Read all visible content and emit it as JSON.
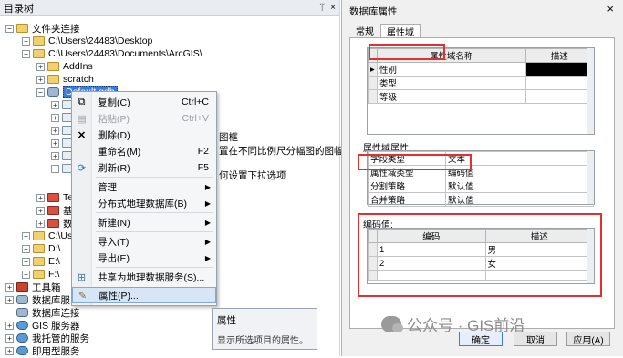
{
  "catalog": {
    "title": "目录树",
    "pin": "ᛘ",
    "close": "×",
    "root": "文件夹连接",
    "nodes": [
      {
        "expander": "+",
        "label": "C:\\Users\\24483\\Desktop"
      },
      {
        "expander": "−",
        "label": "C:\\Users\\24483\\Documents\\ArcGIS\\"
      },
      {
        "expander": "+",
        "label": "AddIns"
      },
      {
        "expander": "+",
        "label": "scratch"
      },
      {
        "expander": "−",
        "label": "Default.gdb"
      }
    ],
    "partial_nodes": [
      "Te",
      "基",
      "数",
      "C:\\Us",
      "D:\\",
      "E:\\",
      "F:\\"
    ],
    "bottom_nodes": [
      {
        "expander": "+",
        "label": "工具箱"
      },
      {
        "expander": "+",
        "label": "数据库服"
      },
      {
        "expander": "",
        "label": "数据库连接"
      },
      {
        "expander": "+",
        "label": "GIS 服务器"
      },
      {
        "expander": "+",
        "label": "我托管的服务"
      },
      {
        "expander": "+",
        "label": "即用型服务"
      }
    ],
    "background_fragments": [
      "图框",
      "置在不同比例尺分幅图的图幅号",
      "何设置下拉选项"
    ]
  },
  "context_menu": {
    "items": [
      {
        "icon": "copy-icon",
        "label": "复制(C)",
        "shortcut": "Ctrl+C",
        "disabled": false,
        "submenu": false
      },
      {
        "icon": "paste-icon",
        "label": "粘贴(P)",
        "shortcut": "Ctrl+V",
        "disabled": true,
        "submenu": false
      },
      {
        "icon": "delete-icon",
        "label": "删除(D)",
        "shortcut": "",
        "disabled": false,
        "submenu": false
      },
      {
        "icon": "",
        "label": "重命名(M)",
        "shortcut": "F2",
        "disabled": false,
        "submenu": false
      },
      {
        "icon": "refresh-icon",
        "label": "刷新(R)",
        "shortcut": "F5",
        "disabled": false,
        "submenu": false
      },
      {
        "icon": "",
        "label": "管理",
        "shortcut": "",
        "disabled": false,
        "submenu": true
      },
      {
        "icon": "",
        "label": "分布式地理数据库(B)",
        "shortcut": "",
        "disabled": false,
        "submenu": true
      },
      {
        "icon": "",
        "label": "新建(N)",
        "shortcut": "",
        "disabled": false,
        "submenu": true
      },
      {
        "icon": "",
        "label": "导入(T)",
        "shortcut": "",
        "disabled": false,
        "submenu": true
      },
      {
        "icon": "",
        "label": "导出(E)",
        "shortcut": "",
        "disabled": false,
        "submenu": true
      },
      {
        "icon": "share-icon",
        "label": "共享为地理数据服务(S)...",
        "shortcut": "",
        "disabled": false,
        "submenu": false
      },
      {
        "icon": "properties-icon",
        "label": "属性(P)...",
        "shortcut": "",
        "disabled": false,
        "submenu": false
      }
    ]
  },
  "tooltip": {
    "title": "属性",
    "description": "显示所选项目的属性。"
  },
  "dialog": {
    "title": "数据库属性",
    "close": "×",
    "tabs": [
      "常规",
      "属性域"
    ],
    "active_tab": "属性域",
    "domain_grid": {
      "headers": [
        "属性域名称",
        "描述"
      ],
      "rows": [
        "性别",
        "类型",
        "等级"
      ]
    },
    "domain_props_label": "属性域属性:",
    "domain_props": [
      {
        "name": "字段类型",
        "value": "文本"
      },
      {
        "name": "属性域类型",
        "value": "编码值"
      },
      {
        "name": "分割策略",
        "value": "默认值"
      },
      {
        "name": "合并策略",
        "value": "默认值"
      }
    ],
    "coded_label": "编码值:",
    "coded_grid": {
      "headers": [
        "编码",
        "描述"
      ],
      "rows": [
        {
          "code": "1",
          "desc": "男"
        },
        {
          "code": "2",
          "desc": "女"
        }
      ]
    },
    "buttons": {
      "ok": "确定",
      "cancel": "取消",
      "apply": "应用(A)"
    }
  },
  "watermark": "公众号 · GIS前沿",
  "colors": {
    "selection": "#3d7bd9",
    "highlight_box": "#e03030"
  }
}
